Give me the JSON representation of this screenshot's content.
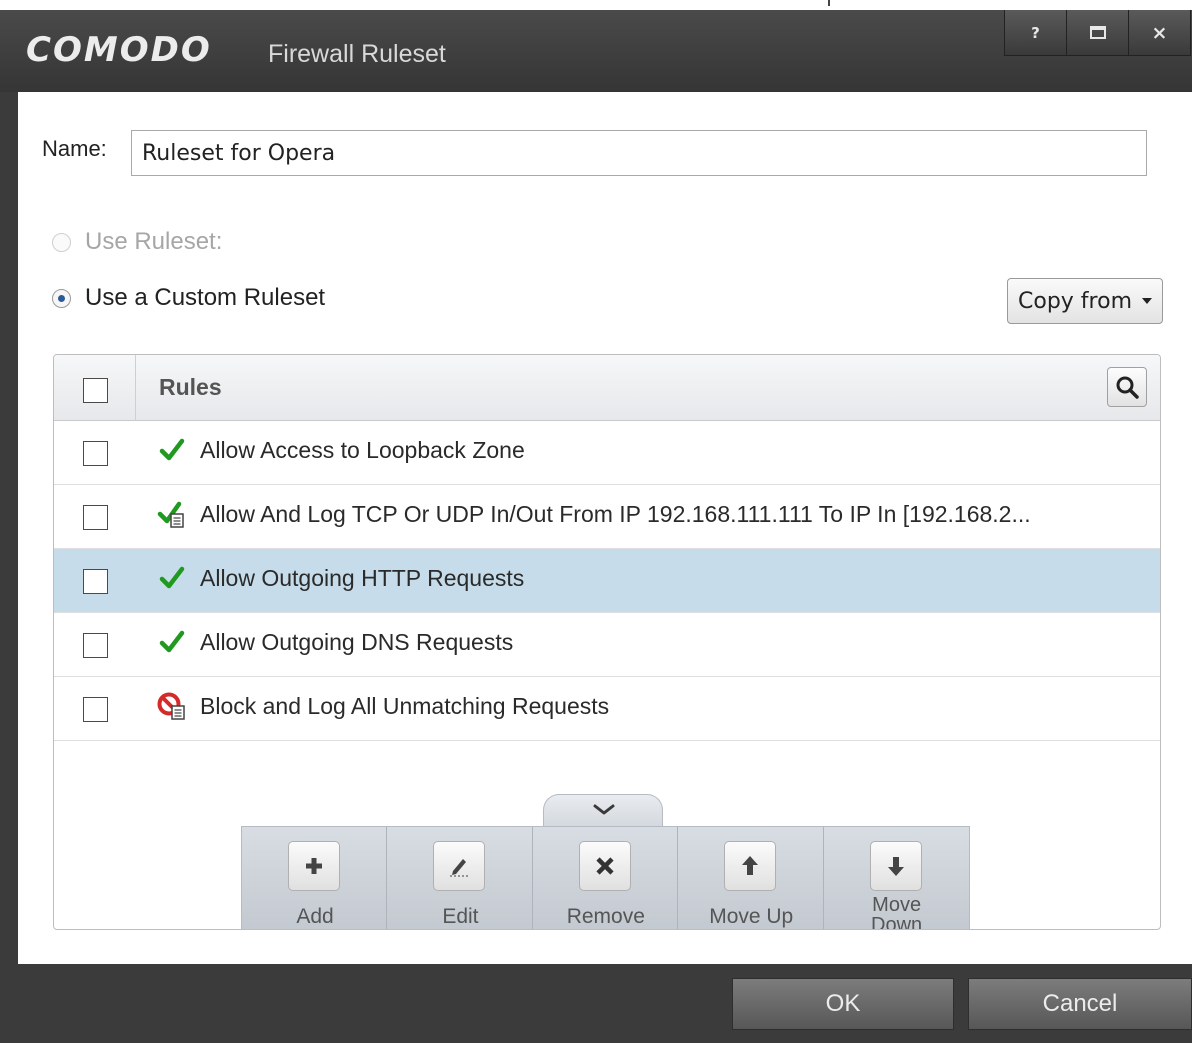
{
  "window": {
    "brand": "COMODO",
    "title": "Firewall Ruleset",
    "help_glyph": "?",
    "close_glyph": "×"
  },
  "form": {
    "name_label": "Name:",
    "name_value": "Ruleset for Opera",
    "option_use_ruleset": "Use Ruleset:",
    "option_custom_ruleset": "Use a Custom Ruleset",
    "selected_option": "Use a Custom Ruleset",
    "copy_from_label": "Copy from"
  },
  "table": {
    "header": "Rules",
    "rows": [
      {
        "label": "Allow Access to Loopback Zone",
        "icon": "allow-icon",
        "selected": false
      },
      {
        "label": "Allow And Log TCP Or UDP In/Out From IP 192.168.111.111 To IP In [192.168.2...",
        "icon": "allow-log-icon",
        "selected": false
      },
      {
        "label": "Allow Outgoing HTTP Requests",
        "icon": "allow-icon",
        "selected": true
      },
      {
        "label": "Allow Outgoing DNS Requests",
        "icon": "allow-icon",
        "selected": false
      },
      {
        "label": "Block and Log All Unmatching Requests",
        "icon": "block-log-icon",
        "selected": false
      }
    ]
  },
  "toolbar": {
    "add": "Add",
    "edit": "Edit",
    "remove": "Remove",
    "move_up": "Move Up",
    "move_down_line1": "Move",
    "move_down_line2": "Down"
  },
  "footer": {
    "ok": "OK",
    "cancel": "Cancel"
  },
  "colors": {
    "title_bar": "#3b3b3b",
    "selected_row": "#c7dcea",
    "allow_green": "#1f9a1f",
    "block_red": "#d42a2a"
  }
}
